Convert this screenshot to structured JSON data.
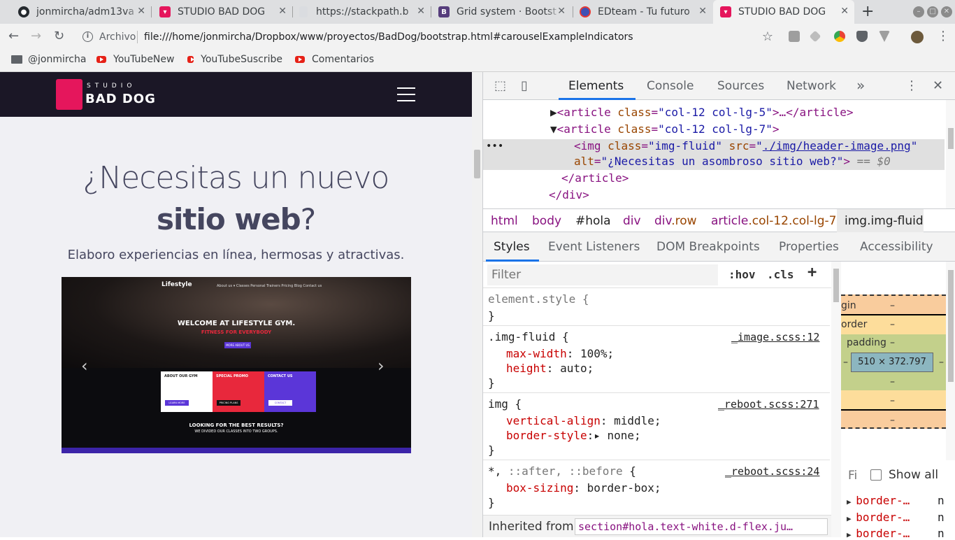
{
  "tabs": [
    {
      "title": "jonmircha/adm13va",
      "icon": "github-icon",
      "active": false
    },
    {
      "title": "STUDIO BAD DOG",
      "icon": "baddog-icon",
      "active": false
    },
    {
      "title": "https://stackpath.b",
      "icon": "page-icon",
      "active": false
    },
    {
      "title": "Grid system · Bootst",
      "icon": "bootstrap-icon",
      "active": false
    },
    {
      "title": "EDteam - Tu futuro",
      "icon": "edteam-icon",
      "active": false
    },
    {
      "title": "STUDIO BAD DOG",
      "icon": "baddog-icon",
      "active": true
    }
  ],
  "omnibox": {
    "scheme_label": "Archivo",
    "url": "file:///home/jonmircha/Dropbox/www/proyectos/BadDog/bootstrap.html#carouselExampleIndicators"
  },
  "bookmarks": [
    {
      "label": "@jonmircha",
      "icon": "folder-icon"
    },
    {
      "label": "YouTubeNew",
      "icon": "youtube-icon"
    },
    {
      "label": "YouTubeSuscribe",
      "icon": "youtube-icon"
    },
    {
      "label": "Comentarios",
      "icon": "youtube-icon"
    }
  ],
  "site": {
    "logo_top": "STUDIO",
    "logo_bottom": "BAD DOG",
    "hero_line1": "¿Necesitas un nuevo",
    "hero_bold": "sitio web",
    "hero_q": "?",
    "hero_sub": "Elaboro experiencias en línea, hermosas y atractivas.",
    "shot": {
      "brand": "Lifestyle",
      "menu": "About us ▾    Classes    Personal Trainers    Pricing    Blog    Contact us",
      "welcome": "WELCOME AT LIFESTYLE GYM.",
      "fitness": "FITNESS FOR EVERYBODY",
      "button": "MORE ABOUT US",
      "card1_title": "ABOUT OUR GYM",
      "card1_btn": "LEARN MORE",
      "card2_title": "SPECIAL PROMO",
      "card2_btn": "PRICING PLANS",
      "card3_title": "CONTACT US",
      "card3_btn": "CONTACT",
      "looking": "LOOKING FOR THE BEST RESULTS?",
      "divided": "WE DIVIDED OUR CLASSES INTO TWO GROUPS."
    }
  },
  "devtools": {
    "tabs": [
      "Elements",
      "Console",
      "Sources",
      "Network"
    ],
    "more": "»",
    "dom": {
      "l1_tag": "<article ",
      "l1_attr": "class",
      "l1_val": "\"col-12 col-lg-5\"",
      "l1_rest": ">…</article>",
      "l2_tag": "<article ",
      "l2_attr": "class",
      "l2_val": "\"col-12 col-lg-7\"",
      "l2_rest": ">",
      "l3_tag": "<img ",
      "l3_a1": "class",
      "l3_v1": "\"img-fluid\"",
      "l3_a2": " src",
      "l3_v2_q1": "\"",
      "l3_v2_link": "./img/header-image.png",
      "l3_v2_q2": "\"",
      "l4_a": "alt",
      "l4_v": "\"¿Necesitas un asombroso sitio web?\"",
      "l4_end": ">",
      "l4_eq": " == $0",
      "l5": "</article>",
      "l6": "</div>"
    },
    "crumbs": [
      {
        "tag": "html",
        "cls": ""
      },
      {
        "tag": "body",
        "cls": ""
      },
      {
        "tag": "#hola",
        "cls": ""
      },
      {
        "tag": "div",
        "cls": ""
      },
      {
        "tag": "div",
        "cls": ".row"
      },
      {
        "tag": "article",
        "cls": ".col-12.col-lg-7"
      },
      {
        "tag": "img.img-fluid",
        "cls": ""
      }
    ],
    "subtabs": [
      "Styles",
      "Event Listeners",
      "DOM Breakpoints",
      "Properties",
      "Accessibility"
    ],
    "filter_placeholder": "Filter",
    "hov": ":hov",
    "cls": ".cls",
    "plus": "+",
    "rules": {
      "r0_sel": "element.style {",
      "r0_end": "}",
      "r1_sel": ".img-fluid {",
      "r1_src": "_image.scss:12",
      "r1_p1": "max-width",
      "r1_v1": "100%;",
      "r1_p2": "height",
      "r1_v2": "auto;",
      "r1_end": "}",
      "r2_sel": "img {",
      "r2_src": "_reboot.scss:271",
      "r2_p1": "vertical-align",
      "r2_v1": "middle;",
      "r2_p2": "border-style",
      "r2_v2": "none;",
      "r2_end": "}",
      "r3_sel_a": "*,",
      "r3_sel_b": " ::after, ::before",
      "r3_sel_c": " {",
      "r3_src": "_reboot.scss:24",
      "r3_p1": "box-sizing",
      "r3_v1": "border-box;",
      "r3_end": "}"
    },
    "inherited_label": "Inherited from",
    "inherited_value": "section#hola.text-white.d-flex.ju…",
    "boxmodel": {
      "margin": "gin",
      "border": "order",
      "padding": "padding",
      "dash": "–",
      "size": "510 × 372.797"
    },
    "computed": {
      "filter": "Fi",
      "show_all": "Show all",
      "rows": [
        "border-…",
        "border-…",
        "border-…"
      ],
      "cut": "n"
    }
  },
  "colors": {
    "accent": "#1a73e8",
    "brand": "#e5165c",
    "nav_bg": "#1b1726"
  }
}
